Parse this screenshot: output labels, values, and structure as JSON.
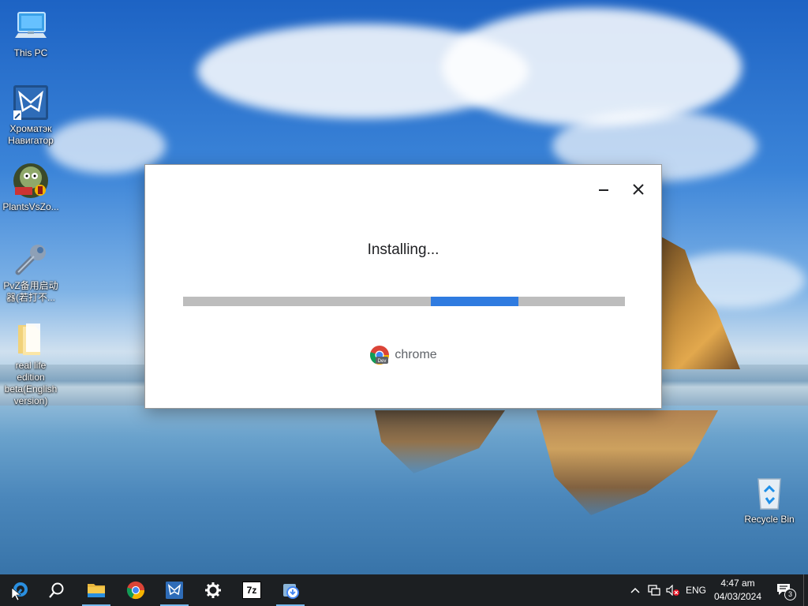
{
  "desktop": {
    "icons": [
      {
        "label": "This PC"
      },
      {
        "label": "Хроматэк Навигатор"
      },
      {
        "label": "PlantsVsZo..."
      },
      {
        "label": "PvZ备用启动器(若打不..."
      },
      {
        "label": "real life edition beta(English version)"
      },
      {
        "label": "Recycle Bin"
      }
    ]
  },
  "installer": {
    "status": "Installing...",
    "progress_indicator": "indeterminate",
    "brand_text": "chrome",
    "badge_text": "Dev",
    "icons": [
      "minimize-icon",
      "close-icon",
      "chrome-dev-logo"
    ]
  },
  "taskbar": {
    "items": [
      "start-button",
      "search-icon",
      "file-explorer-icon",
      "chrome-icon",
      "chromatek-navigator-icon",
      "settings-icon",
      "7zip-icon",
      "installer-icon"
    ],
    "labels": {
      "sevenzip": "7z"
    },
    "tray": {
      "language": "ENG",
      "time": "4:47 am",
      "date": "04/03/2024",
      "notification_count": "3"
    }
  },
  "colors": {
    "progress_fill": "#2f7be0",
    "progress_track": "#bdbdbd",
    "taskbar": "#1c1f22",
    "accent": "#76b9ed"
  }
}
